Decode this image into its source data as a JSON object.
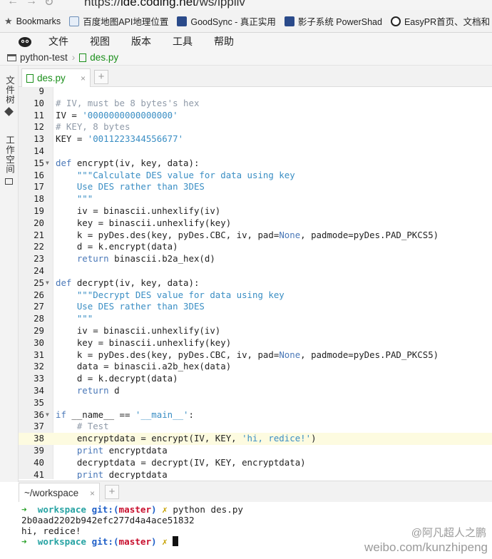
{
  "browser": {
    "back_icon": "back-arrow-icon",
    "forward_icon": "forward-arrow-icon",
    "url_prefix": "https://",
    "url_domain": "ide.coding.net",
    "url_path": "/ws/lppllv"
  },
  "bookmarks": [
    {
      "label": "Bookmarks",
      "icon": "star-icon",
      "color": "#555555"
    },
    {
      "label": "百度地图API地理位置",
      "icon": "page-icon",
      "color": "#6d8fb8"
    },
    {
      "label": "GoodSync - 真正实用",
      "icon": "page-icon",
      "color": "#2a4a8a"
    },
    {
      "label": "影子系统 PowerShad",
      "icon": "page-icon",
      "color": "#2a4a8a"
    },
    {
      "label": "EasyPR首页、文档和",
      "icon": "coding-icon",
      "color": "#222222"
    }
  ],
  "menu": [
    "文件",
    "视图",
    "版本",
    "工具",
    "帮助"
  ],
  "breadcrumb": {
    "project": "python-test",
    "file": "des.py"
  },
  "sidebar": {
    "files_label": "文件树",
    "workspace_label": "工作空间"
  },
  "editor_tab": {
    "label": "des.py",
    "close": "×",
    "add": "+"
  },
  "code_lines": [
    {
      "n": "9",
      "fold": "",
      "active": false,
      "tokens": []
    },
    {
      "n": "10",
      "fold": "",
      "active": false,
      "tokens": [
        {
          "t": "# IV, must be 8 bytes's hex",
          "c": "cm"
        }
      ]
    },
    {
      "n": "11",
      "fold": "",
      "active": false,
      "tokens": [
        {
          "t": "IV = ",
          "c": "plain"
        },
        {
          "t": "'0000000000000000'",
          "c": "str"
        }
      ]
    },
    {
      "n": "12",
      "fold": "",
      "active": false,
      "tokens": [
        {
          "t": "# KEY, 8 bytes",
          "c": "cm"
        }
      ]
    },
    {
      "n": "13",
      "fold": "",
      "active": false,
      "tokens": [
        {
          "t": "KEY = ",
          "c": "plain"
        },
        {
          "t": "'0011223344556677'",
          "c": "str"
        }
      ]
    },
    {
      "n": "14",
      "fold": "",
      "active": false,
      "tokens": []
    },
    {
      "n": "15",
      "fold": "▼",
      "active": false,
      "tokens": [
        {
          "t": "def",
          "c": "kw"
        },
        {
          "t": " encrypt(iv, key, data):",
          "c": "plain"
        }
      ]
    },
    {
      "n": "16",
      "fold": "",
      "active": false,
      "tokens": [
        {
          "t": "    \"\"\"Calculate DES value for data using key",
          "c": "str"
        }
      ]
    },
    {
      "n": "17",
      "fold": "",
      "active": false,
      "tokens": [
        {
          "t": "    Use DES rather than 3DES",
          "c": "str"
        }
      ]
    },
    {
      "n": "18",
      "fold": "",
      "active": false,
      "tokens": [
        {
          "t": "    \"\"\"",
          "c": "str"
        }
      ]
    },
    {
      "n": "19",
      "fold": "",
      "active": false,
      "tokens": [
        {
          "t": "    iv = binascii.unhexlify(iv)",
          "c": "plain"
        }
      ]
    },
    {
      "n": "20",
      "fold": "",
      "active": false,
      "tokens": [
        {
          "t": "    key = binascii.unhexlify(key)",
          "c": "plain"
        }
      ]
    },
    {
      "n": "21",
      "fold": "",
      "active": false,
      "tokens": [
        {
          "t": "    k = pyDes.des(key, pyDes.CBC, iv, pad=",
          "c": "plain"
        },
        {
          "t": "None",
          "c": "none"
        },
        {
          "t": ", padmode=pyDes.PAD_PKCS5)",
          "c": "plain"
        }
      ]
    },
    {
      "n": "22",
      "fold": "",
      "active": false,
      "tokens": [
        {
          "t": "    d = k.encrypt(data)",
          "c": "plain"
        }
      ]
    },
    {
      "n": "23",
      "fold": "",
      "active": false,
      "tokens": [
        {
          "t": "    ",
          "c": "plain"
        },
        {
          "t": "return",
          "c": "kw"
        },
        {
          "t": " binascii.b2a_hex(d)",
          "c": "plain"
        }
      ]
    },
    {
      "n": "24",
      "fold": "",
      "active": false,
      "tokens": []
    },
    {
      "n": "25",
      "fold": "▼",
      "active": false,
      "tokens": [
        {
          "t": "def",
          "c": "kw"
        },
        {
          "t": " decrypt(iv, key, data):",
          "c": "plain"
        }
      ]
    },
    {
      "n": "26",
      "fold": "",
      "active": false,
      "tokens": [
        {
          "t": "    \"\"\"Decrypt DES value for data using key",
          "c": "str"
        }
      ]
    },
    {
      "n": "27",
      "fold": "",
      "active": false,
      "tokens": [
        {
          "t": "    Use DES rather than 3DES",
          "c": "str"
        }
      ]
    },
    {
      "n": "28",
      "fold": "",
      "active": false,
      "tokens": [
        {
          "t": "    \"\"\"",
          "c": "str"
        }
      ]
    },
    {
      "n": "29",
      "fold": "",
      "active": false,
      "tokens": [
        {
          "t": "    iv = binascii.unhexlify(iv)",
          "c": "plain"
        }
      ]
    },
    {
      "n": "30",
      "fold": "",
      "active": false,
      "tokens": [
        {
          "t": "    key = binascii.unhexlify(key)",
          "c": "plain"
        }
      ]
    },
    {
      "n": "31",
      "fold": "",
      "active": false,
      "tokens": [
        {
          "t": "    k = pyDes.des(key, pyDes.CBC, iv, pad=",
          "c": "plain"
        },
        {
          "t": "None",
          "c": "none"
        },
        {
          "t": ", padmode=pyDes.PAD_PKCS5)",
          "c": "plain"
        }
      ]
    },
    {
      "n": "32",
      "fold": "",
      "active": false,
      "tokens": [
        {
          "t": "    data = binascii.a2b_hex(data)",
          "c": "plain"
        }
      ]
    },
    {
      "n": "33",
      "fold": "",
      "active": false,
      "tokens": [
        {
          "t": "    d = k.decrypt(data)",
          "c": "plain"
        }
      ]
    },
    {
      "n": "34",
      "fold": "",
      "active": false,
      "tokens": [
        {
          "t": "    ",
          "c": "plain"
        },
        {
          "t": "return",
          "c": "kw"
        },
        {
          "t": " d",
          "c": "plain"
        }
      ]
    },
    {
      "n": "35",
      "fold": "",
      "active": false,
      "tokens": []
    },
    {
      "n": "36",
      "fold": "▼",
      "active": false,
      "tokens": [
        {
          "t": "if",
          "c": "kw"
        },
        {
          "t": " __name__ == ",
          "c": "plain"
        },
        {
          "t": "'__main__'",
          "c": "str"
        },
        {
          "t": ":",
          "c": "plain"
        }
      ]
    },
    {
      "n": "37",
      "fold": "",
      "active": false,
      "tokens": [
        {
          "t": "    # Test",
          "c": "cm"
        }
      ]
    },
    {
      "n": "38",
      "fold": "",
      "active": true,
      "tokens": [
        {
          "t": "    encryptdata = encrypt(IV, KEY, ",
          "c": "plain"
        },
        {
          "t": "'hi, redice!'",
          "c": "str"
        },
        {
          "t": ")",
          "c": "plain"
        }
      ]
    },
    {
      "n": "39",
      "fold": "",
      "active": false,
      "tokens": [
        {
          "t": "    ",
          "c": "plain"
        },
        {
          "t": "print",
          "c": "kw"
        },
        {
          "t": " encryptdata",
          "c": "plain"
        }
      ]
    },
    {
      "n": "40",
      "fold": "",
      "active": false,
      "tokens": [
        {
          "t": "    decryptdata = decrypt(IV, KEY, encryptdata)",
          "c": "plain"
        }
      ]
    },
    {
      "n": "41",
      "fold": "",
      "active": false,
      "tokens": [
        {
          "t": "    ",
          "c": "plain"
        },
        {
          "t": "print",
          "c": "kw"
        },
        {
          "t": " decryptdata",
          "c": "plain"
        }
      ]
    }
  ],
  "terminal_tab": {
    "label": "~/workspace",
    "close": "×",
    "add": "+"
  },
  "terminal": {
    "arrow": "➜",
    "workspace": "workspace",
    "git": "git:",
    "branch_open": "(",
    "branch": "master",
    "branch_close": ")",
    "dirty": "✗",
    "command": "python des.py",
    "output1": "2b0aad2202b942efc277d4a4ace51832",
    "output2": "hi, redice!"
  },
  "watermark": {
    "handle": "@阿凡超人之鹏",
    "site": "weibo.com/kunzhipeng"
  },
  "colors": {
    "keyword": "#4a78b8",
    "string": "#3a8ec4",
    "comment": "#8f9aa8",
    "active_line": "#fdfbe0",
    "py_green": "#1a8f1a"
  }
}
